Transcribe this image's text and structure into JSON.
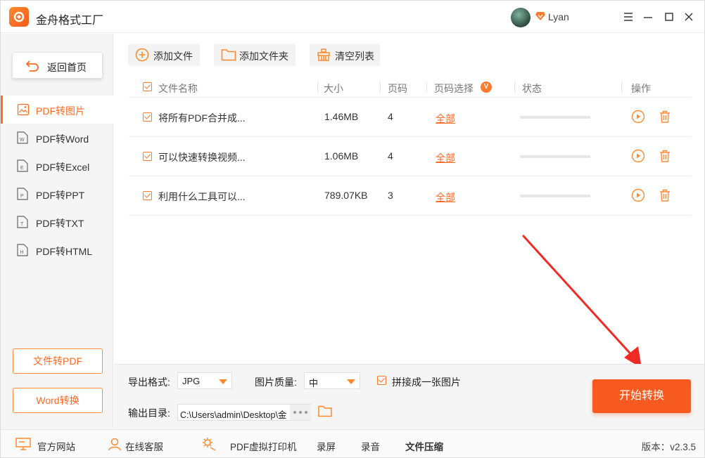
{
  "app": {
    "title": "金舟格式工厂",
    "username": "Lyan"
  },
  "sidebar": {
    "home_label": "返回首页",
    "items": [
      {
        "label": "PDF转图片",
        "active": true,
        "icon": "image-file-icon"
      },
      {
        "label": "PDF转Word",
        "icon": "word-file-icon"
      },
      {
        "label": "PDF转Excel",
        "icon": "excel-file-icon"
      },
      {
        "label": "PDF转PPT",
        "icon": "ppt-file-icon"
      },
      {
        "label": "PDF转TXT",
        "icon": "txt-file-icon"
      },
      {
        "label": "PDF转HTML",
        "icon": "html-file-icon"
      }
    ],
    "bottom_buttons": [
      "文件转PDF",
      "Word转换"
    ]
  },
  "toolbar": {
    "add_file": "添加文件",
    "add_folder": "添加文件夹",
    "clear_list": "清空列表"
  },
  "table": {
    "headers": {
      "name": "文件名称",
      "size": "大小",
      "pages": "页码",
      "page_select": "页码选择",
      "page_select_badge": "V",
      "status": "状态",
      "actions": "操作"
    },
    "rows": [
      {
        "name": "将所有PDF合并成...",
        "size": "1.46MB",
        "pages": "4",
        "page_select": "全部",
        "progress": 0
      },
      {
        "name": "可以快速转换视频...",
        "size": "1.06MB",
        "pages": "4",
        "page_select": "全部",
        "progress": 0
      },
      {
        "name": "利用什么工具可以...",
        "size": "789.07KB",
        "pages": "3",
        "page_select": "全部",
        "progress": 0
      }
    ]
  },
  "settings": {
    "format_label": "导出格式:",
    "format_value": "JPG",
    "quality_label": "图片质量:",
    "quality_value": "中",
    "merge_label": "拼接成一张图片",
    "output_label": "输出目录:",
    "output_path": "C:\\Users\\admin\\Desktop\\金",
    "start_button": "开始转换"
  },
  "footer": {
    "items": [
      "官方网站",
      "在线客服",
      "PDF虚拟打印机",
      "录屏",
      "录音",
      "文件压缩"
    ],
    "version": "版本：v2.3.5"
  },
  "colors": {
    "accent": "#ff6a20",
    "start_button": "#f65a1e",
    "arrow": "#ee2b24"
  }
}
